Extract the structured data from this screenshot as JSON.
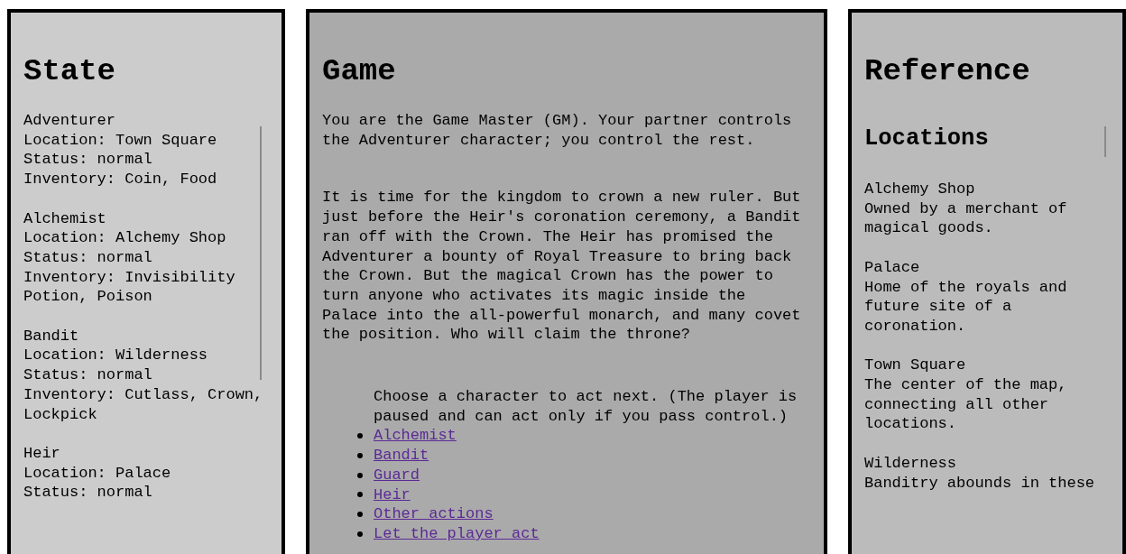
{
  "state": {
    "title": "State",
    "characters": [
      {
        "name": "Adventurer",
        "lines": [
          "Location: Town Square",
          "Status: normal",
          "Inventory: Coin, Food"
        ]
      },
      {
        "name": "Alchemist",
        "lines": [
          "Location: Alchemy Shop",
          "Status: normal",
          "Inventory: Invisibility Potion, Poison"
        ]
      },
      {
        "name": "Bandit",
        "lines": [
          "Location: Wilderness",
          "Status: normal",
          "Inventory: Cutlass, Crown, Lockpick"
        ]
      },
      {
        "name": "Heir",
        "lines": [
          "Location: Palace",
          "Status: normal"
        ]
      }
    ]
  },
  "game": {
    "title": "Game",
    "paragraphs": [
      "You are the Game Master (GM). Your partner controls the Adventurer character; you control the rest.",
      "It is time for the kingdom to crown a new ruler. But just before the Heir's coronation ceremony, a Bandit ran off with the Crown. The Heir has promised the Adventurer a bounty of Royal Treasure to bring back the Crown. But the magical Crown has the power to turn anyone who activates its magic inside the Palace into the all-powerful monarch, and many covet the position. Who will claim the throne?"
    ],
    "prompt": "Choose a character to act next. (The player is paused and can act only if you pass control.)",
    "options": [
      {
        "label": "Alchemist"
      },
      {
        "label": "Bandit"
      },
      {
        "label": "Guard"
      },
      {
        "label": "Heir"
      },
      {
        "label": "Other actions"
      },
      {
        "label": "Let the player act"
      }
    ]
  },
  "reference": {
    "title": "Reference",
    "section": "Locations",
    "locations": [
      {
        "name": "Alchemy Shop",
        "description": "Owned by a merchant of magical goods."
      },
      {
        "name": "Palace",
        "description": "Home of the royals and future site of a coronation."
      },
      {
        "name": "Town Square",
        "description": "The center of the map, connecting all other locations."
      },
      {
        "name": "Wilderness",
        "description": "Banditry abounds in these"
      }
    ]
  }
}
